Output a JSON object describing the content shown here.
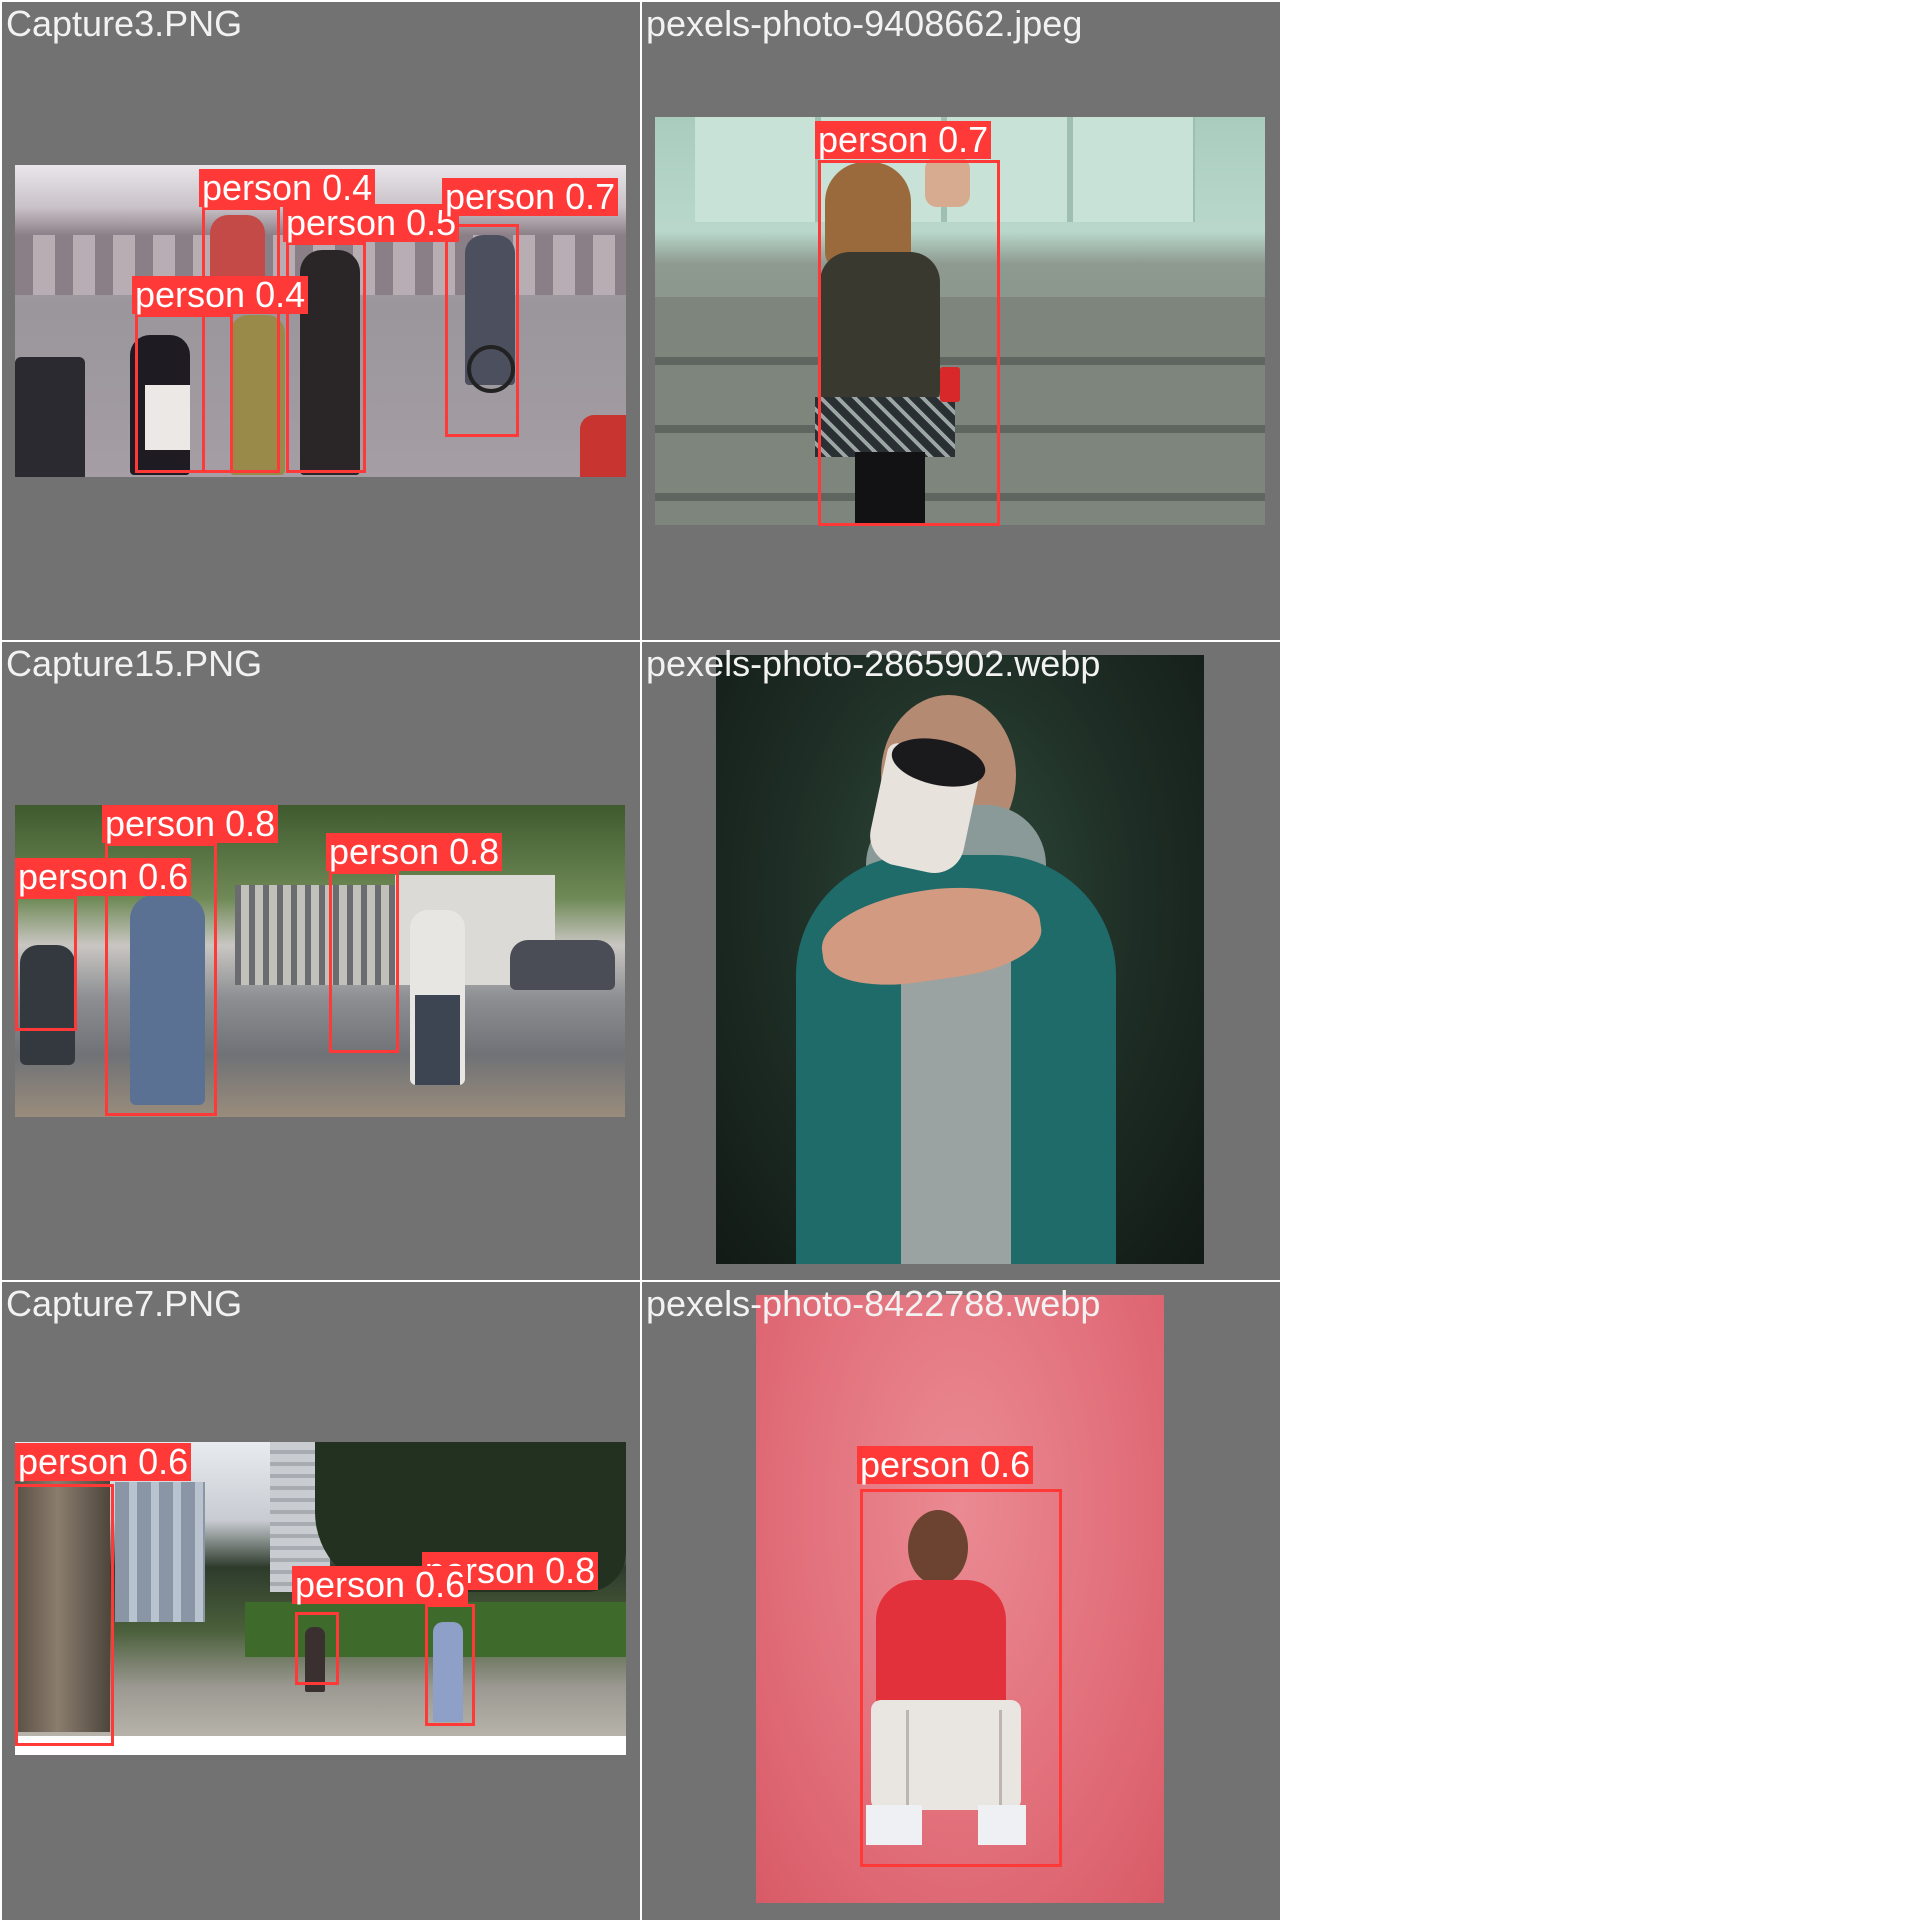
{
  "colors": {
    "tile_background": "#727272",
    "box": "#ff3838",
    "label_text": "#ffffff",
    "filename_text": "#f2f2f2"
  },
  "tiles": [
    {
      "filename": "Capture3.PNG",
      "detections": [
        {
          "label": "person 0.4"
        },
        {
          "label": "person 0.7"
        },
        {
          "label": "person 0.5"
        },
        {
          "label": "person 0.4"
        }
      ]
    },
    {
      "filename": "pexels-photo-9408662.jpeg",
      "detections": [
        {
          "label": "person 0.7"
        }
      ]
    },
    {
      "filename": "Capture15.PNG",
      "detections": [
        {
          "label": "person 0.8"
        },
        {
          "label": "person 0.8"
        },
        {
          "label": "person 0.6"
        }
      ]
    },
    {
      "filename": "pexels-photo-2865902.webp",
      "detections": []
    },
    {
      "filename": "Capture7.PNG",
      "detections": [
        {
          "label": "person 0.6"
        },
        {
          "label": "person 0.8"
        },
        {
          "label": "person 0.6"
        }
      ]
    },
    {
      "filename": "pexels-photo-8422788.webp",
      "detections": [
        {
          "label": "person 0.6"
        }
      ]
    }
  ]
}
